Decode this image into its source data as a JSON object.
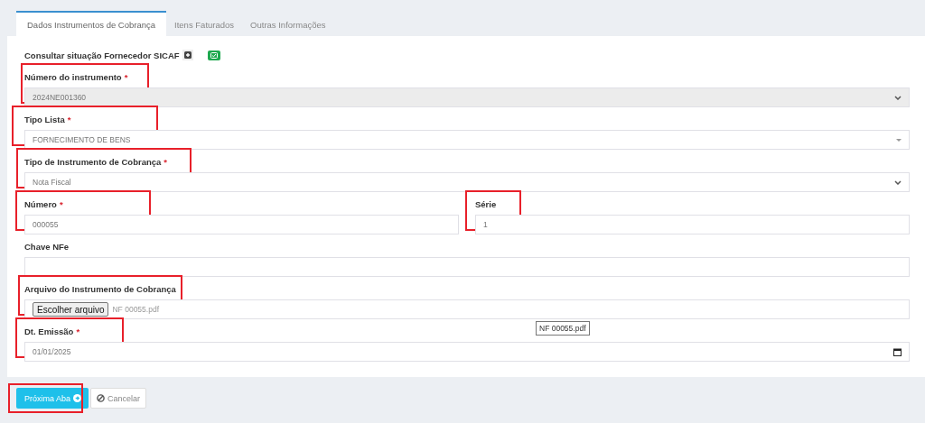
{
  "tabs": [
    {
      "label": "Dados Instrumentos de Cobrança",
      "selected": true
    },
    {
      "label": "Itens Faturados",
      "selected": false
    },
    {
      "label": "Outras Informações",
      "selected": false
    }
  ],
  "sicaf": {
    "label": "Consultar situação Fornecedor SICAF"
  },
  "rows": [
    {
      "fields": [
        {
          "label": "Número do instrumento",
          "required_mark": "*",
          "kind": "select",
          "value": "2024NE001360",
          "disabled": true,
          "highlighted": true
        }
      ]
    },
    {
      "fields": [
        {
          "label": "Tipo Lista",
          "required_mark": "*",
          "kind": "combobox",
          "value": "FORNECIMENTO DE BENS",
          "disabled": false,
          "highlighted": true
        }
      ]
    },
    {
      "fields": [
        {
          "label": "Tipo de Instrumento de Cobrança",
          "required_mark": "*",
          "kind": "select",
          "value": "Nota Fiscal",
          "disabled": false,
          "highlighted": true
        }
      ]
    },
    {
      "fields": [
        {
          "label": "Número",
          "required_mark": "*",
          "kind": "text",
          "value": "000055",
          "disabled": false,
          "highlighted": true
        },
        {
          "label": "Série",
          "kind": "text",
          "value": "1",
          "disabled": false,
          "highlighted": true
        }
      ]
    },
    {
      "fields": [
        {
          "label": "Chave NFe",
          "kind": "text",
          "disabled": false,
          "highlighted": false
        }
      ]
    },
    {
      "fields": [
        {
          "label": "Arquivo do Instrumento de Cobrança",
          "kind": "file",
          "button": "Escolher arquivo",
          "value": "NF 00055.pdf",
          "tooltip": "NF 00055.pdf",
          "disabled": false,
          "highlighted": true
        }
      ]
    },
    {
      "fields": [
        {
          "label": "Dt. Emissão",
          "required_mark": "*",
          "kind": "date",
          "value": "01/01/2025",
          "disabled": false,
          "highlighted": true
        }
      ]
    }
  ],
  "buttons": [
    {
      "label": "Próxima Aba",
      "kind": "primary",
      "highlighted": true
    },
    {
      "label": "Cancelar",
      "kind": "default",
      "highlighted": false
    }
  ]
}
